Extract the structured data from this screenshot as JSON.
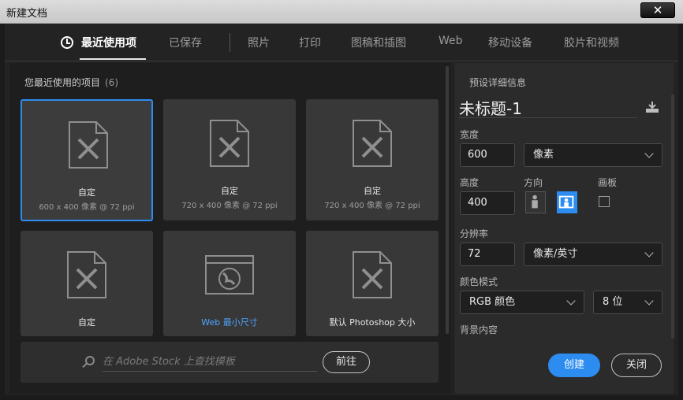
{
  "window": {
    "title": "新建文档",
    "close_glyph": "✕"
  },
  "tabs": [
    {
      "label": "最近使用项",
      "active": true
    },
    {
      "label": "已保存"
    },
    {
      "label": "照片"
    },
    {
      "label": "打印"
    },
    {
      "label": "图稿和插图"
    },
    {
      "label": "Web"
    },
    {
      "label": "移动设备"
    },
    {
      "label": "胶片和视频"
    }
  ],
  "recent": {
    "title": "您最近使用的项目",
    "count": "(6)",
    "items": [
      {
        "name": "自定",
        "spec": "600 x 400 像素 @ 72 ppi",
        "icon": "document-ruler-pencil-icon",
        "selected": true
      },
      {
        "name": "自定",
        "spec": "720 x 400 像素 @ 72 ppi",
        "icon": "document-ruler-pencil-icon"
      },
      {
        "name": "自定",
        "spec": "720 x 400 像素 @ 72 ppi",
        "icon": "document-ruler-pencil-icon"
      },
      {
        "name": "自定",
        "spec": "",
        "icon": "document-ruler-pencil-icon"
      },
      {
        "name": "Web 最小尺寸",
        "spec": "",
        "icon": "browser-globe-icon"
      },
      {
        "name": "默认 Photoshop 大小",
        "spec": "",
        "icon": "document-ruler-pencil-icon"
      }
    ]
  },
  "stock_search": {
    "placeholder": "在 Adobe Stock 上查找模板",
    "go_label": "前往"
  },
  "preset": {
    "section_title": "预设详细信息",
    "doc_name": "未标题-1",
    "width_label": "宽度",
    "width_value": "600",
    "width_unit": "像素",
    "height_label": "高度",
    "height_value": "400",
    "orientation_label": "方向",
    "artboard_label": "画板",
    "resolution_label": "分辨率",
    "resolution_value": "72",
    "resolution_unit": "像素/英寸",
    "color_mode_label": "颜色模式",
    "color_mode_value": "RGB 颜色",
    "bit_depth_value": "8 位",
    "background_label": "背景内容"
  },
  "actions": {
    "create_label": "创建",
    "close_label": "关闭"
  },
  "colors": {
    "accent": "#2d8cf0",
    "background": "#232323",
    "panel": "#2b2b2b"
  }
}
